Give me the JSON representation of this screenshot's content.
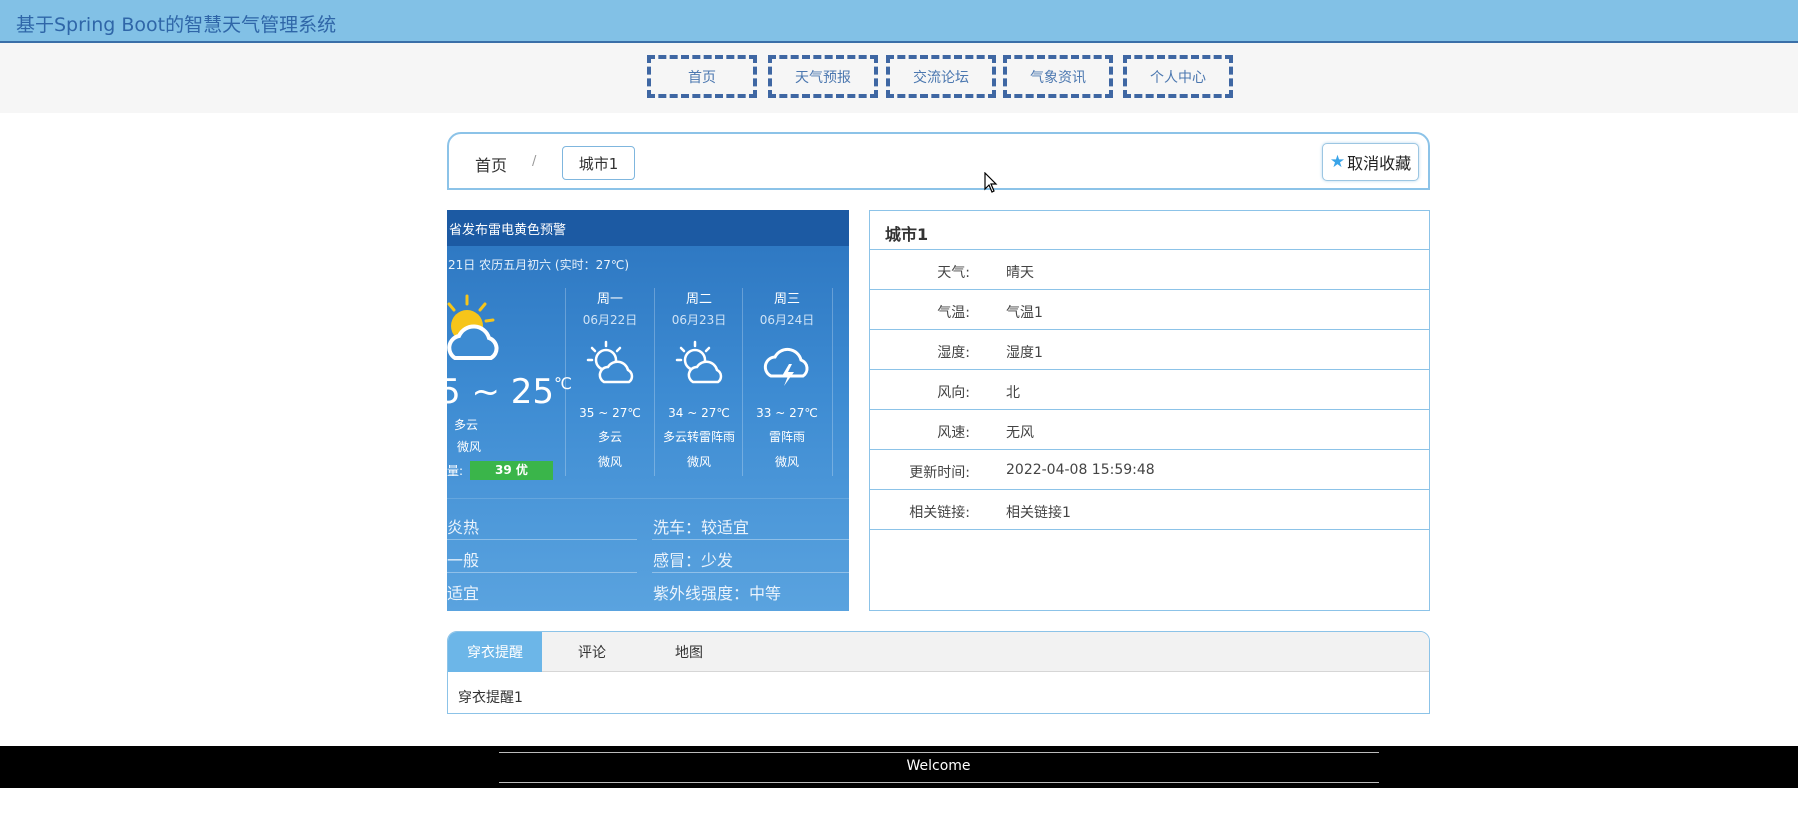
{
  "header": {
    "title": "基于Spring Boot的智慧天气管理系统"
  },
  "nav": {
    "items": [
      {
        "label": "首页"
      },
      {
        "label": "天气预报"
      },
      {
        "label": "交流论坛"
      },
      {
        "label": "气象资讯"
      },
      {
        "label": "个人中心"
      }
    ]
  },
  "breadcrumb": {
    "home": "首页",
    "separator": "/",
    "current": "城市1"
  },
  "favorite": {
    "label": "取消收藏",
    "icon": "star-icon",
    "icon_color": "#3aa4e8"
  },
  "weather_image": {
    "banner": "省发布雷电黄色预警",
    "subline": "21日 农历五月初六 (实时：27℃)",
    "today": {
      "temp": "~ 25",
      "temp_prefix": "5",
      "unit": "℃",
      "condition": "多云",
      "wind": "微风",
      "aqi_label": "量:",
      "aqi_value": "39 优"
    },
    "days": [
      {
        "name": "周一",
        "date": "06月22日",
        "temp": "35 ~ 27℃",
        "cond": "多云",
        "wind": "微风",
        "icon": "partly-cloudy-icon"
      },
      {
        "name": "周二",
        "date": "06月23日",
        "temp": "34 ~ 27℃",
        "cond": "多云转雷阵雨",
        "wind": "微风",
        "icon": "partly-cloudy-icon"
      },
      {
        "name": "周三",
        "date": "06月24日",
        "temp": "33 ~ 27℃",
        "cond": "雷阵雨",
        "wind": "微风",
        "icon": "thunderstorm-icon"
      }
    ],
    "life_index": {
      "left": [
        "炎热",
        "一般",
        "适宜"
      ],
      "right": [
        "洗车：较适宜",
        "感冒：少发",
        "紫外线强度：中等"
      ]
    }
  },
  "detail": {
    "title": "城市1",
    "rows": [
      {
        "key": "天气:",
        "value": "晴天"
      },
      {
        "key": "气温:",
        "value": "气温1"
      },
      {
        "key": "湿度:",
        "value": "湿度1"
      },
      {
        "key": "风向:",
        "value": "北"
      },
      {
        "key": "风速:",
        "value": "无风"
      },
      {
        "key": "更新时间:",
        "value": "2022-04-08 15:59:48"
      },
      {
        "key": "相关链接:",
        "value": "相关链接1"
      }
    ]
  },
  "tabs": {
    "items": [
      {
        "label": "穿衣提醒"
      },
      {
        "label": "评论"
      },
      {
        "label": "地图"
      }
    ],
    "active_content": "穿衣提醒1",
    "active_color": "#6cb6e8"
  },
  "footer": {
    "text": "Welcome"
  }
}
